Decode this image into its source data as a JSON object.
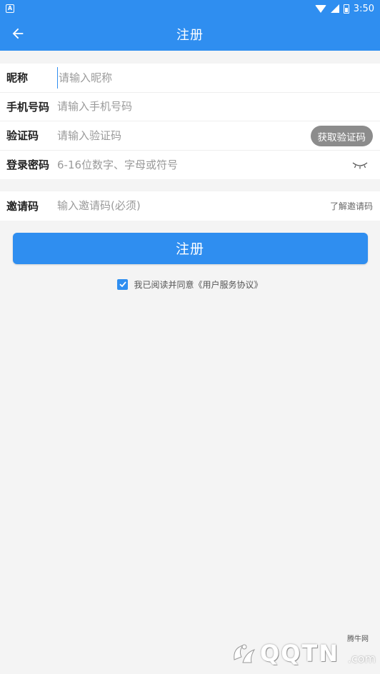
{
  "status_bar": {
    "time": "3:50",
    "notification_icon": "A"
  },
  "app_bar": {
    "title": "注册",
    "back_icon": "arrow-left-icon"
  },
  "form": {
    "nickname": {
      "label": "昵称",
      "placeholder": "请输入昵称",
      "value": ""
    },
    "phone": {
      "label": "手机号码",
      "placeholder": "请输入手机号码",
      "value": ""
    },
    "code": {
      "label": "验证码",
      "placeholder": "请输入验证码",
      "value": "",
      "button_label": "获取验证码"
    },
    "password": {
      "label": "登录密码",
      "placeholder": "6-16位数字、字母或符号",
      "value": "",
      "toggle_icon": "eye-closed-icon"
    },
    "invite": {
      "label": "邀请码",
      "placeholder": "输入邀请码(必须)",
      "value": "",
      "link_label": "了解邀请码"
    }
  },
  "submit_label": "注册",
  "agreement": {
    "checked": true,
    "text": "我已阅读并同意《用户服务协议》"
  },
  "watermark": {
    "small_text": "腾牛网",
    "brand_text": "QQTN",
    "suffix_text": ".com"
  },
  "colors": {
    "primary": "#2f8ef0",
    "background": "#f4f4f4",
    "code_button": "#8c8c8c"
  }
}
